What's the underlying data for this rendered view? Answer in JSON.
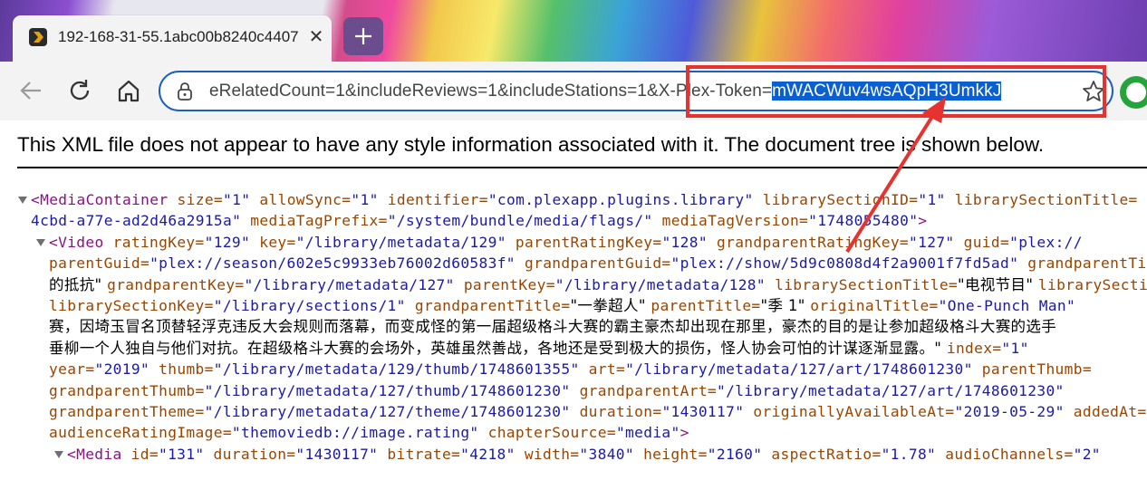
{
  "tab": {
    "title": "192-168-31-55.1abc00b8240c4407",
    "close_label": "✕",
    "new_tab_label": "+"
  },
  "address_bar": {
    "url_visible_prefix": "eRelatedCount=1&includeReviews=1&includeStations=1&X-Plex-Token=",
    "url_selected": "mWACWuv4wsAQpH3UmkkJ"
  },
  "content": {
    "notice": "This XML file does not appear to have any style information associated with it. The document tree is shown below.",
    "xml_lines": [
      [
        [
          "tag",
          "<MediaContainer "
        ],
        [
          "attr",
          "size="
        ],
        [
          "val",
          "\"1\" "
        ],
        [
          "attr",
          "allowSync="
        ],
        [
          "val",
          "\"1\" "
        ],
        [
          "attr",
          "identifier="
        ],
        [
          "val",
          "\"com.plexapp.plugins.library\" "
        ],
        [
          "attr",
          "librarySectionID="
        ],
        [
          "val",
          "\"1\" "
        ],
        [
          "attr",
          "librarySectionTitle="
        ]
      ],
      [
        [
          "val",
          "4cbd-a77e-ad2d46a2915a\" "
        ],
        [
          "attr",
          "mediaTagPrefix="
        ],
        [
          "val",
          "\"/system/bundle/media/flags/\" "
        ],
        [
          "attr",
          "mediaTagVersion="
        ],
        [
          "val",
          "\"1748055480\""
        ],
        [
          "tag",
          ">"
        ]
      ],
      [
        [
          "tag",
          "<Video "
        ],
        [
          "attr",
          "ratingKey="
        ],
        [
          "val",
          "\"129\" "
        ],
        [
          "attr",
          "key="
        ],
        [
          "val",
          "\"/library/metadata/129\" "
        ],
        [
          "attr",
          "parentRatingKey="
        ],
        [
          "val",
          "\"128\" "
        ],
        [
          "attr",
          "grandparentRatingKey="
        ],
        [
          "val",
          "\"127\" "
        ],
        [
          "attr",
          "guid="
        ],
        [
          "val",
          "\"plex://"
        ]
      ],
      [
        [
          "attr",
          "parentGuid="
        ],
        [
          "val",
          "\"plex://season/602e5c9933eb76002d60583f\" "
        ],
        [
          "attr",
          "grandparentGuid="
        ],
        [
          "val",
          "\"plex://show/5d9c0808d4f2a9001f7fd5ad\" "
        ],
        [
          "attr",
          "grandparentTitle="
        ]
      ],
      [
        [
          "txt",
          "的抵抗\" "
        ],
        [
          "attr",
          "grandparentKey="
        ],
        [
          "val",
          "\"/library/metadata/127\" "
        ],
        [
          "attr",
          "parentKey="
        ],
        [
          "val",
          "\"/library/metadata/128\" "
        ],
        [
          "attr",
          "librarySectionTitle="
        ],
        [
          "txt",
          "\"电视节目\" "
        ],
        [
          "attr",
          "librarySectionID="
        ]
      ],
      [
        [
          "attr",
          "librarySectionKey="
        ],
        [
          "val",
          "\"/library/sections/1\" "
        ],
        [
          "attr",
          "grandparentTitle="
        ],
        [
          "txt",
          "\"一拳超人\" "
        ],
        [
          "attr",
          "parentTitle="
        ],
        [
          "txt",
          "\"季 1\" "
        ],
        [
          "attr",
          "originalTitle="
        ],
        [
          "val",
          "\"One-Punch Man\""
        ]
      ],
      [
        [
          "txt",
          "赛，因埼玉冒名顶替轻浮克违反大会规则而落幕，而变成怪的第一届超级格斗大赛的霸主豪杰却出现在那里，豪杰的目的是让参加超级格斗大赛的选手"
        ]
      ],
      [
        [
          "txt",
          "垂柳一个人独自与他们对抗。在超级格斗大赛的会场外，英雄虽然善战，各地还是受到极大的损伤，怪人协会可怕的计谋逐渐显露。\" "
        ],
        [
          "attr",
          "index="
        ],
        [
          "val",
          "\"1\""
        ]
      ],
      [
        [
          "attr",
          "year="
        ],
        [
          "val",
          "\"2019\" "
        ],
        [
          "attr",
          "thumb="
        ],
        [
          "val",
          "\"/library/metadata/129/thumb/1748601355\" "
        ],
        [
          "attr",
          "art="
        ],
        [
          "val",
          "\"/library/metadata/127/art/1748601230\" "
        ],
        [
          "attr",
          "parentThumb="
        ]
      ],
      [
        [
          "attr",
          "grandparentThumb="
        ],
        [
          "val",
          "\"/library/metadata/127/thumb/1748601230\" "
        ],
        [
          "attr",
          "grandparentArt="
        ],
        [
          "val",
          "\"/library/metadata/127/art/1748601230\""
        ]
      ],
      [
        [
          "attr",
          "grandparentTheme="
        ],
        [
          "val",
          "\"/library/metadata/127/theme/1748601230\" "
        ],
        [
          "attr",
          "duration="
        ],
        [
          "val",
          "\"1430117\" "
        ],
        [
          "attr",
          "originallyAvailableAt="
        ],
        [
          "val",
          "\"2019-05-29\" "
        ],
        [
          "attr",
          "addedAt="
        ]
      ],
      [
        [
          "attr",
          "audienceRatingImage="
        ],
        [
          "val",
          "\"themoviedb://image.rating\" "
        ],
        [
          "attr",
          "chapterSource="
        ],
        [
          "val",
          "\"media\""
        ],
        [
          "tag",
          ">"
        ]
      ],
      [
        [
          "tag",
          "<Media "
        ],
        [
          "attr",
          "id="
        ],
        [
          "val",
          "\"131\" "
        ],
        [
          "attr",
          "duration="
        ],
        [
          "val",
          "\"1430117\" "
        ],
        [
          "attr",
          "bitrate="
        ],
        [
          "val",
          "\"4218\" "
        ],
        [
          "attr",
          "width="
        ],
        [
          "val",
          "\"3840\" "
        ],
        [
          "attr",
          "height="
        ],
        [
          "val",
          "\"2160\" "
        ],
        [
          "attr",
          "aspectRatio="
        ],
        [
          "val",
          "\"1.78\" "
        ],
        [
          "attr",
          "audioChannels="
        ],
        [
          "val",
          "\"2\""
        ]
      ]
    ]
  }
}
